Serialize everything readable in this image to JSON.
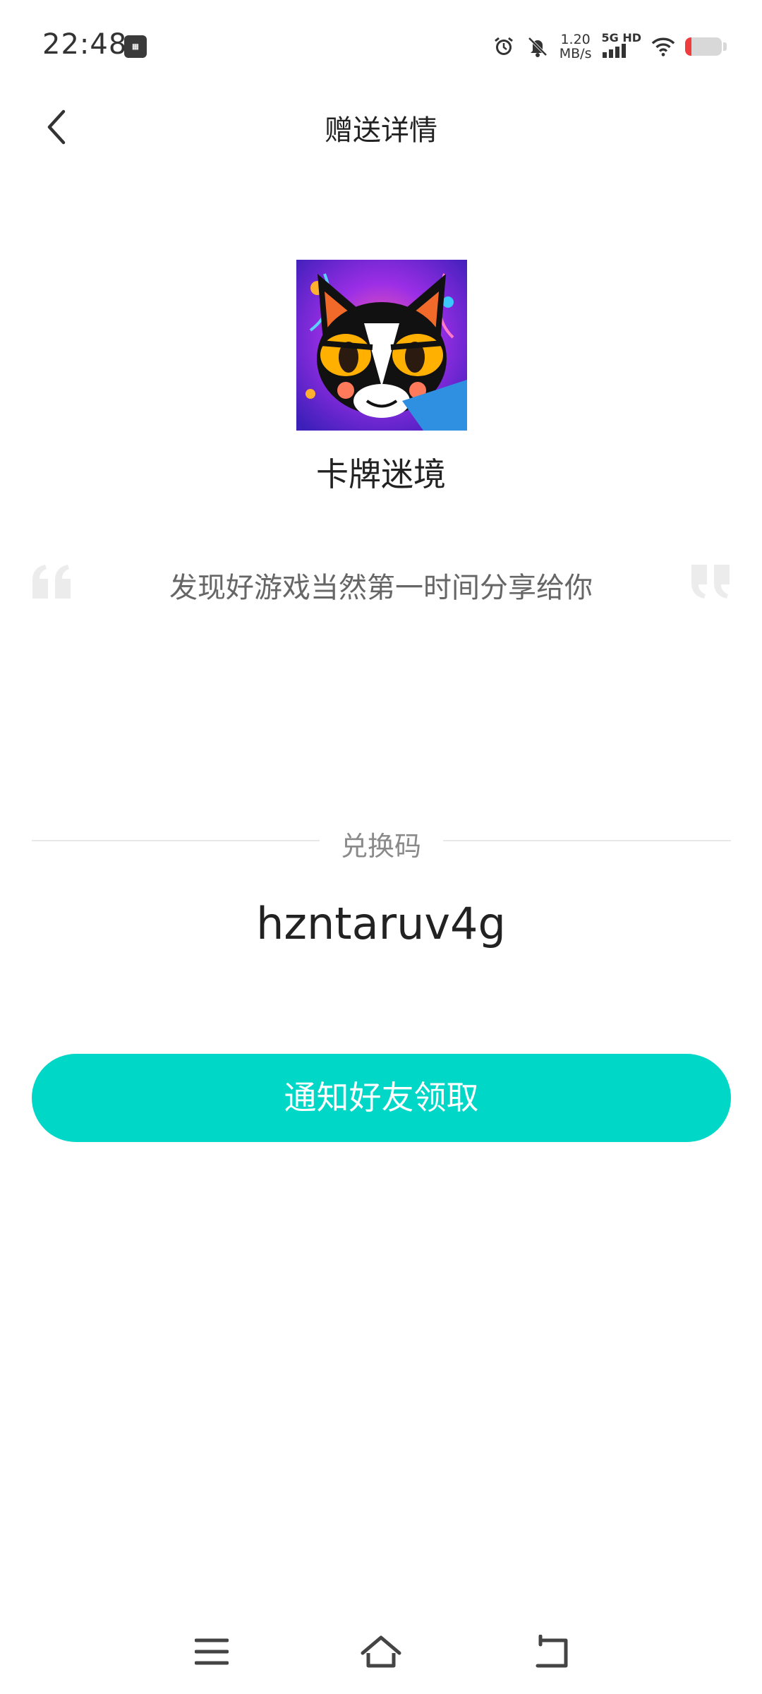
{
  "status_bar": {
    "time": "22:48",
    "net_speed_value": "1.20",
    "net_speed_unit": "MB/s",
    "network_label": "5G HD",
    "battery_level": 0.18,
    "battery_color": "#f03c3c"
  },
  "header": {
    "title": "赠送详情"
  },
  "game": {
    "name": "卡牌迷境"
  },
  "share": {
    "message": "发现好游戏当然第一时间分享给你"
  },
  "redeem": {
    "label": "兑换码",
    "code": "hzntaruv4g"
  },
  "actions": {
    "notify_label": "通知好友领取"
  },
  "colors": {
    "accent": "#00d7c6"
  }
}
